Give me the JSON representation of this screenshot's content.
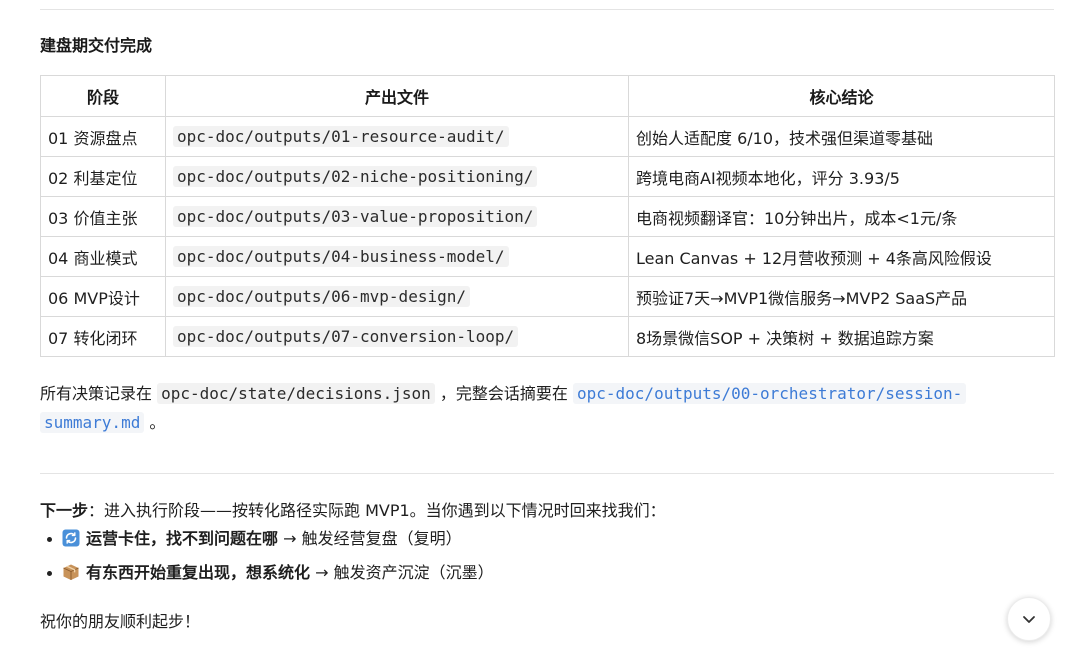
{
  "section_title": "建盘期交付完成",
  "table": {
    "headers": [
      "阶段",
      "产出文件",
      "核心结论"
    ],
    "rows": [
      {
        "stage": "01 资源盘点",
        "file": "opc-doc/outputs/01-resource-audit/",
        "conclusion": "创始人适配度 6/10，技术强但渠道零基础"
      },
      {
        "stage": "02 利基定位",
        "file": "opc-doc/outputs/02-niche-positioning/",
        "conclusion": "跨境电商AI视频本地化，评分 3.93/5"
      },
      {
        "stage": "03 价值主张",
        "file": "opc-doc/outputs/03-value-proposition/",
        "conclusion": "电商视频翻译官：10分钟出片，成本<1元/条"
      },
      {
        "stage": "04 商业模式",
        "file": "opc-doc/outputs/04-business-model/",
        "conclusion": "Lean Canvas + 12月营收预测 + 4条高风险假设"
      },
      {
        "stage": "06 MVP设计",
        "file": "opc-doc/outputs/06-mvp-design/",
        "conclusion": "预验证7天→MVP1微信服务→MVP2 SaaS产品"
      },
      {
        "stage": "07 转化闭环",
        "file": "opc-doc/outputs/07-conversion-loop/",
        "conclusion": "8场景微信SOP + 决策树 + 数据追踪方案"
      }
    ]
  },
  "summary": {
    "prefix": "所有决策记录在 ",
    "decisions_path": "opc-doc/state/decisions.json",
    "middle": " ，完整会话摘要在 ",
    "session_path_1": "opc-doc/outputs/00-orchestrator/session-",
    "session_path_2": "summary.md",
    "suffix": " 。"
  },
  "next_step": {
    "label": "下一步",
    "text": "：进入执行阶段——按转化路径实际跑 MVP1。当你遇到以下情况时回来找我们：",
    "items": [
      {
        "icon": "refresh-icon",
        "bold": "运营卡住，找不到问题在哪",
        "rest": " → 触发经营复盘（复明）"
      },
      {
        "icon": "package-icon",
        "bold": "有东西开始重复出现，想系统化",
        "rest": " → 触发资产沉淀（沉墨）"
      }
    ]
  },
  "farewell": "祝你的朋友顺利起步！",
  "colors": {
    "link": "#3d7bd6",
    "border": "#d9d9d9",
    "code_bg": "#f2f2f2"
  }
}
